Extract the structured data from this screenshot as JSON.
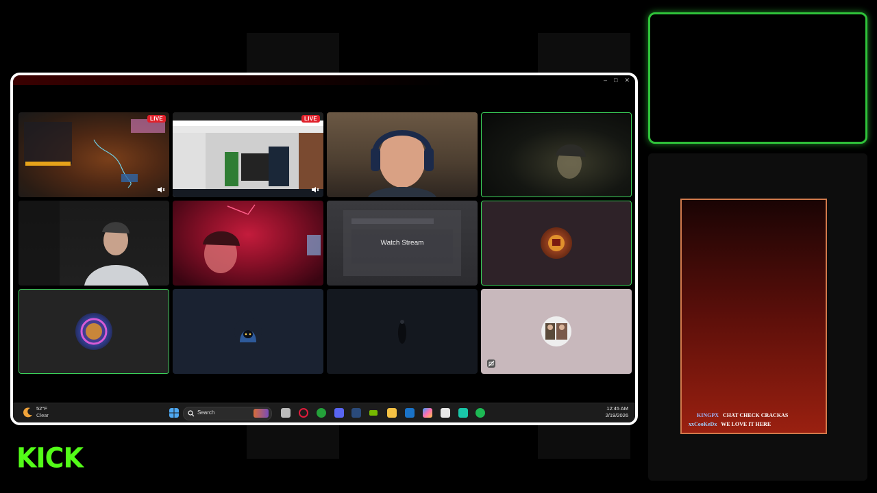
{
  "stream": {
    "brand": "KICK",
    "brand_color": "#53fc18",
    "frame_border_color": "#ffffff",
    "speaking_color": "#3bd15a"
  },
  "window": {
    "controls": [
      "–",
      "□",
      "✕"
    ]
  },
  "tiles": [
    {
      "kind": "screen",
      "badge": "LIVE",
      "speaking": false
    },
    {
      "kind": "screen",
      "badge": "LIVE",
      "speaking": false
    },
    {
      "kind": "camera",
      "badge": "",
      "speaking": false
    },
    {
      "kind": "camera",
      "badge": "",
      "speaking": true
    },
    {
      "kind": "camera",
      "badge": "",
      "speaking": false
    },
    {
      "kind": "camera",
      "badge": "",
      "speaking": false
    },
    {
      "kind": "watch",
      "badge": "",
      "speaking": false,
      "label": "Watch Stream"
    },
    {
      "kind": "avatar",
      "badge": "",
      "speaking": true
    },
    {
      "kind": "avatar",
      "badge": "",
      "speaking": true
    },
    {
      "kind": "avatar",
      "badge": "",
      "speaking": false
    },
    {
      "kind": "empty",
      "badge": "",
      "speaking": false
    },
    {
      "kind": "avatar",
      "badge": "",
      "speaking": false
    }
  ],
  "taskbar": {
    "weather_temp": "52°F",
    "weather_desc": "Clear",
    "search_placeholder": "Search",
    "time": "12:45 AM",
    "date": "2/19/2026",
    "icons": [
      "start-icon",
      "task-view-icon",
      "opera-icon",
      "xbox-icon",
      "discord-icon",
      "steam-icon",
      "nvidia-icon",
      "file-explorer-icon",
      "outlook-icon",
      "copilot-icon",
      "store-icon",
      "app-icon",
      "spotify-icon"
    ]
  },
  "chat": {
    "messages": [
      {
        "user": "KINGPX",
        "user_color": "#9db8ff",
        "text": "CHAT CHECK CRACKAS"
      },
      {
        "user": "xxCooKeDx",
        "user_color": "#9fd1ff",
        "text": "WE LOVE IT HERE"
      }
    ]
  }
}
